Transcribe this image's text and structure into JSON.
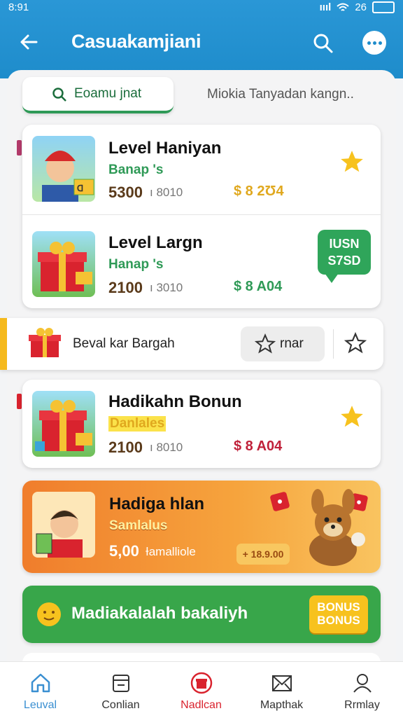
{
  "status": {
    "time": "8:91",
    "network": "ıııl",
    "data": "26"
  },
  "header": {
    "title": "Casuakamjiani"
  },
  "tabs": {
    "active_label": "Eoamu jnat",
    "secondary_label": "Miokia Tanyadan kangn.."
  },
  "cards": [
    {
      "title": "Level Haniyan",
      "subtitle": "Banap 's",
      "price": "5300",
      "muted": "ı 8010",
      "value": "$ 8 2Ʊ4"
    },
    {
      "title": "Level Largn",
      "subtitle": "Hanap 's",
      "price": "2100",
      "muted": "ı 3010",
      "value": "$ 8 A04",
      "bubble": [
        "IUSN",
        "S7SD"
      ]
    }
  ],
  "banner": {
    "text": "Beval kar Bargah",
    "button_label": "rnar"
  },
  "card3": {
    "title": "Hadikahn Bonun",
    "subtitle": "Danlales",
    "price": "2100",
    "muted": "ı 8010",
    "value": "$ 8 A04"
  },
  "promo": {
    "title": "Hadiga hlan",
    "subtitle": "Samlalus",
    "price": "5,00",
    "note": "Ɨamalliole",
    "pill": "+ 18.9.00"
  },
  "green": {
    "text": "Madiakalalah bakaliyh",
    "bonus1": "BONUS",
    "bonus2": "BONUS"
  },
  "nav": [
    {
      "label": "Leuval",
      "icon": "home-icon"
    },
    {
      "label": "Conlian",
      "icon": "calendar-icon"
    },
    {
      "label": "Nadlcan",
      "icon": "gift-icon"
    },
    {
      "label": "Mapthak",
      "icon": "mail-icon"
    },
    {
      "label": "Rrmlay",
      "icon": "profile-icon"
    }
  ],
  "colors": {
    "header": "#1e8ccb",
    "green": "#2f9a57",
    "orange": "#f07d2c",
    "nav_active": "#3a8fd1",
    "nav_gift": "#d9232e"
  }
}
